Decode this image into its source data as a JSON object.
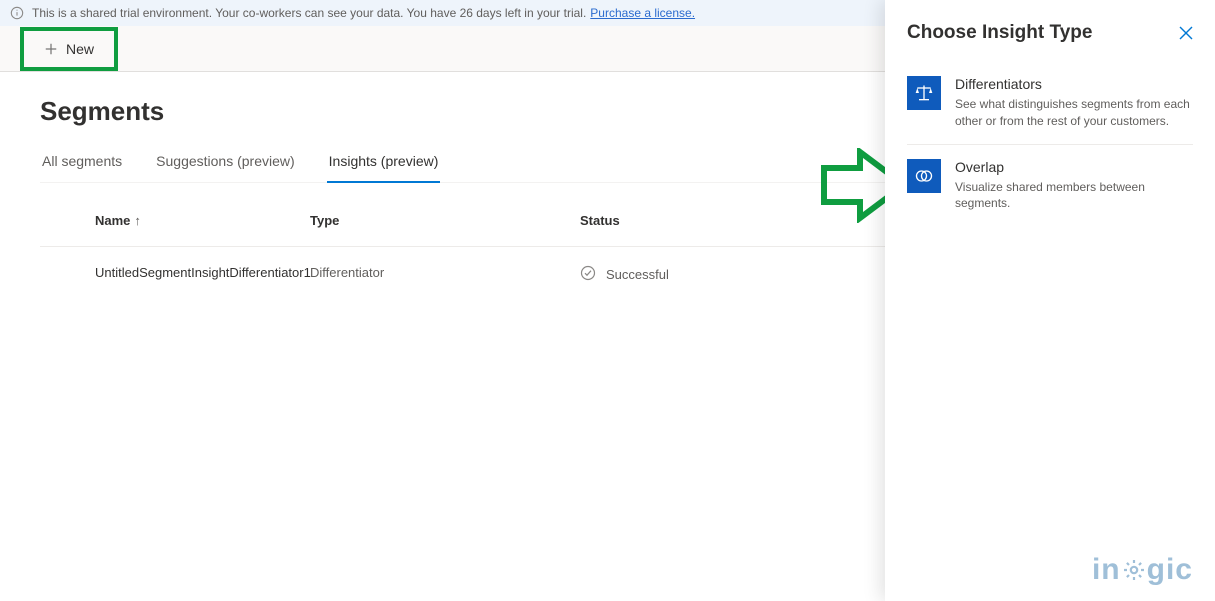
{
  "banner": {
    "text": "This is a shared trial environment. Your co-workers can see your data. You have 26 days left in your trial.",
    "link": "Purchase a license."
  },
  "toolbar": {
    "new": "New"
  },
  "page": {
    "title": "Segments"
  },
  "tabs": {
    "items": [
      {
        "label": "All segments"
      },
      {
        "label": "Suggestions (preview)"
      },
      {
        "label": "Insights (preview)"
      }
    ],
    "active_index": 2
  },
  "table": {
    "headers": {
      "name": "Name",
      "type": "Type",
      "status": "Status"
    },
    "sort_indicator": "↑",
    "rows": [
      {
        "name": "UntitledSegmentInsightDifferentiator1",
        "type": "Differentiator",
        "status": "Successful"
      }
    ]
  },
  "panel": {
    "title": "Choose Insight Type",
    "options": [
      {
        "title": "Differentiators",
        "desc": "See what distinguishes segments from each other or from the rest of your customers."
      },
      {
        "title": "Overlap",
        "desc": "Visualize shared members between segments."
      }
    ]
  },
  "watermark": {
    "pre": "in",
    "post": "gic"
  }
}
